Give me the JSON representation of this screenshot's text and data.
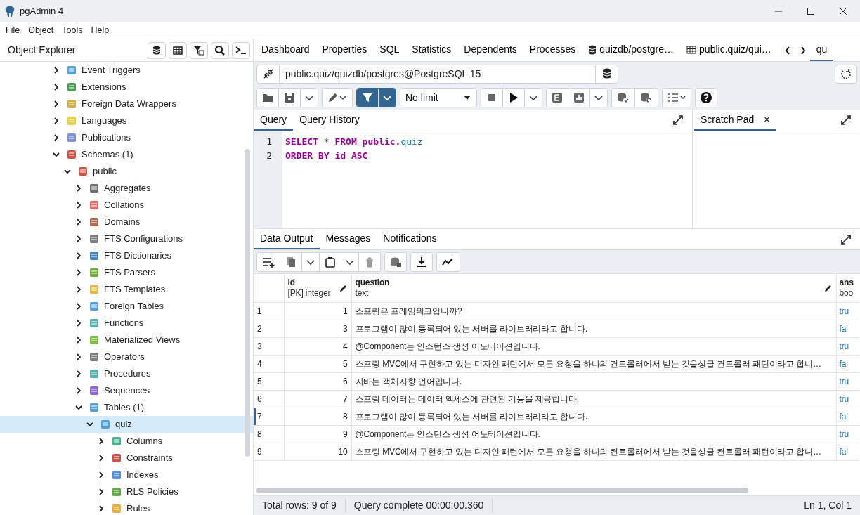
{
  "window": {
    "title": "pgAdmin 4"
  },
  "menu": [
    "File",
    "Object",
    "Tools",
    "Help"
  ],
  "explorer": {
    "title": "Object Explorer",
    "tree": [
      {
        "label": "Event Triggers",
        "expanded": false,
        "selected": false
      },
      {
        "label": "Extensions",
        "expanded": false,
        "selected": false
      },
      {
        "label": "Foreign Data Wrappers",
        "expanded": false,
        "selected": false
      },
      {
        "label": "Languages",
        "expanded": false,
        "selected": false
      },
      {
        "label": "Publications",
        "expanded": false,
        "selected": false
      },
      {
        "label": "Schemas (1)",
        "expanded": true,
        "selected": false,
        "children": [
          {
            "label": "public",
            "expanded": true,
            "selected": false,
            "children": [
              {
                "label": "Aggregates",
                "expanded": false,
                "selected": false
              },
              {
                "label": "Collations",
                "expanded": false,
                "selected": false
              },
              {
                "label": "Domains",
                "expanded": false,
                "selected": false
              },
              {
                "label": "FTS Configurations",
                "expanded": false,
                "selected": false
              },
              {
                "label": "FTS Dictionaries",
                "expanded": false,
                "selected": false
              },
              {
                "label": "FTS Parsers",
                "expanded": false,
                "selected": false
              },
              {
                "label": "FTS Templates",
                "expanded": false,
                "selected": false
              },
              {
                "label": "Foreign Tables",
                "expanded": false,
                "selected": false
              },
              {
                "label": "Functions",
                "expanded": false,
                "selected": false
              },
              {
                "label": "Materialized Views",
                "expanded": false,
                "selected": false
              },
              {
                "label": "Operators",
                "expanded": false,
                "selected": false
              },
              {
                "label": "Procedures",
                "expanded": false,
                "selected": false
              },
              {
                "label": "Sequences",
                "expanded": false,
                "selected": false
              },
              {
                "label": "Tables (1)",
                "expanded": true,
                "selected": false,
                "children": [
                  {
                    "label": "quiz",
                    "expanded": true,
                    "selected": true,
                    "children": [
                      {
                        "label": "Columns",
                        "expanded": false,
                        "selected": false
                      },
                      {
                        "label": "Constraints",
                        "expanded": false,
                        "selected": false
                      },
                      {
                        "label": "Indexes",
                        "expanded": false,
                        "selected": false
                      },
                      {
                        "label": "RLS Policies",
                        "expanded": false,
                        "selected": false
                      },
                      {
                        "label": "Rules",
                        "expanded": false,
                        "selected": false
                      }
                    ]
                  }
                ]
              }
            ]
          }
        ]
      }
    ]
  },
  "tabs": [
    {
      "label": "Dashboard",
      "kind": "plain",
      "selected": false
    },
    {
      "label": "Properties",
      "kind": "plain",
      "selected": false
    },
    {
      "label": "SQL",
      "kind": "plain",
      "selected": false
    },
    {
      "label": "Statistics",
      "kind": "plain",
      "selected": false
    },
    {
      "label": "Dependents",
      "kind": "plain",
      "selected": false
    },
    {
      "label": "Processes",
      "kind": "plain",
      "selected": false
    },
    {
      "label": "quizdb/postgre…",
      "kind": "database",
      "selected": false
    },
    {
      "label": "public.quiz/qui…",
      "kind": "table",
      "selected": false
    },
    {
      "label": "qu",
      "kind": "plain",
      "selected": true
    }
  ],
  "connection": "public.quiz/quizdb/postgres@PostgreSQL 15",
  "row_limit": "No limit",
  "editor_tabs": [
    {
      "label": "Query",
      "selected": true
    },
    {
      "label": "Query History",
      "selected": false
    }
  ],
  "scratch_pad": {
    "label": "Scratch Pad",
    "close": "×"
  },
  "code": [
    {
      "number": "1",
      "tokens": [
        {
          "text": "SELECT",
          "kind": "keyword"
        },
        {
          "text": "*",
          "kind": "operator"
        },
        {
          "text": "FROM",
          "kind": "keyword"
        },
        {
          "text": "public.",
          "kind": "keyword"
        },
        {
          "text": "quiz",
          "kind": "name"
        }
      ]
    },
    {
      "number": "2",
      "tokens": [
        {
          "text": "ORDER",
          "kind": "keyword"
        },
        {
          "text": "BY",
          "kind": "keyword"
        },
        {
          "text": "id",
          "kind": "keyword"
        },
        {
          "text": "ASC",
          "kind": "keyword"
        }
      ]
    }
  ],
  "output_tabs": [
    {
      "label": "Data Output",
      "selected": true
    },
    {
      "label": "Messages",
      "selected": false
    },
    {
      "label": "Notifications",
      "selected": false
    }
  ],
  "grid": {
    "columns": [
      {
        "name": "id",
        "type": "[PK] integer",
        "editable": true
      },
      {
        "name": "question",
        "type": "text",
        "editable": true
      },
      {
        "name": "ans",
        "type": "boo",
        "editable": false
      }
    ],
    "rows": [
      {
        "number": "1",
        "selected": false,
        "cells": [
          "1",
          "스프링은 프레임워크입니까?",
          "tru"
        ]
      },
      {
        "number": "2",
        "selected": false,
        "cells": [
          "3",
          "프로그램이 많이 등록되어 있는 서버를 라이브러리라고 합니다.",
          "fal"
        ]
      },
      {
        "number": "3",
        "selected": false,
        "cells": [
          "4",
          "@Component는 인스턴스 생성 어노테이션입니다.",
          "tru"
        ]
      },
      {
        "number": "4",
        "selected": false,
        "cells": [
          "5",
          "스프링 MVC에서 구현하고 있는 디자인 패턴에서 모든 요청을 하나의 컨트롤러에서 받는 것을싱글 컨트롤러 패턴이라고 합니…",
          "fal"
        ]
      },
      {
        "number": "5",
        "selected": false,
        "cells": [
          "6",
          "자바는 객체지향 언어입니다.",
          "tru"
        ]
      },
      {
        "number": "6",
        "selected": false,
        "cells": [
          "7",
          "스프링 데이터는 데이터 액세스에 관련된 기능을 제공합니다.",
          "tru"
        ]
      },
      {
        "number": "7",
        "selected": true,
        "cells": [
          "8",
          "프로그램이 많이 등록되어 있는 서버를 라이브러리라고 합니다.",
          "fal"
        ]
      },
      {
        "number": "8",
        "selected": false,
        "cells": [
          "9",
          "@Component는 인스턴스 생성 어노테이션입니다.",
          "tru"
        ]
      },
      {
        "number": "9",
        "selected": false,
        "cells": [
          "10",
          "스프링 MVC에서 구현하고 있는 디자인 패턴에서 모든 요청을 하나의 컨트롤러에서 받는 것을싱글 컨트롤러 패턴이라고 합니…",
          "fal"
        ]
      }
    ]
  },
  "status_bar": {
    "rows": "Total rows: 9 of 9",
    "query": "Query complete 00:00:00.360",
    "cursor": "Ln 1, Col 1"
  }
}
